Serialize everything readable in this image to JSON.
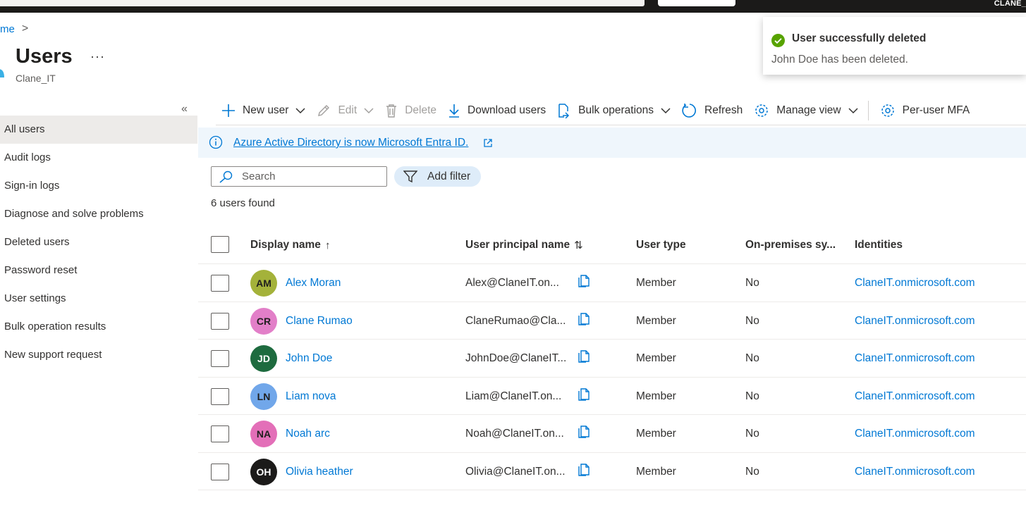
{
  "topbar": {
    "tenant": "CLANE_"
  },
  "breadcrumb": {
    "home": "me",
    "separator": ">"
  },
  "page": {
    "title": "Users",
    "more": "···",
    "subtitle": "Clane_IT"
  },
  "sidebar": {
    "collapse": "«",
    "items": [
      {
        "label": "All users",
        "active": true
      },
      {
        "label": "Audit logs"
      },
      {
        "label": "Sign-in logs"
      },
      {
        "label": "Diagnose and solve problems"
      },
      {
        "label": "Deleted users"
      },
      {
        "label": "Password reset"
      },
      {
        "label": "User settings"
      },
      {
        "label": "Bulk operation results"
      },
      {
        "label": "New support request"
      }
    ]
  },
  "toolbar": {
    "new_user": "New user",
    "edit": "Edit",
    "delete": "Delete",
    "download": "Download users",
    "bulk": "Bulk operations",
    "refresh": "Refresh",
    "manage_view": "Manage view",
    "mfa": "Per-user MFA"
  },
  "banner": {
    "text": "Azure Active Directory is now Microsoft Entra ID."
  },
  "filters": {
    "search_placeholder": "Search",
    "add_filter": "Add filter"
  },
  "result_count": "6 users found",
  "table": {
    "columns": {
      "display_name": "Display name",
      "display_name_sort": "↑",
      "upn": "User principal name",
      "upn_sort": "⇅",
      "user_type": "User type",
      "onprem": "On-premises sy...",
      "identities": "Identities"
    },
    "rows": [
      {
        "initials": "AM",
        "avatar_color": "#a4b23a",
        "name": "Alex Moran",
        "upn": "Alex@ClaneIT.on...",
        "type": "Member",
        "onprem": "No",
        "identity": "ClaneIT.onmicrosoft.com"
      },
      {
        "initials": "CR",
        "avatar_color": "#e27fc8",
        "name": "Clane Rumao",
        "upn": "ClaneRumao@Cla...",
        "type": "Member",
        "onprem": "No",
        "identity": "ClaneIT.onmicrosoft.com"
      },
      {
        "initials": "JD",
        "avatar_color": "#1e6b3f",
        "name": "John Doe",
        "upn": "JohnDoe@ClaneIT...",
        "type": "Member",
        "onprem": "No",
        "identity": "ClaneIT.onmicrosoft.com"
      },
      {
        "initials": "LN",
        "avatar_color": "#71a7ea",
        "name": "Liam nova",
        "upn": "Liam@ClaneIT.on...",
        "type": "Member",
        "onprem": "No",
        "identity": "ClaneIT.onmicrosoft.com"
      },
      {
        "initials": "NA",
        "avatar_color": "#e36fb8",
        "name": "Noah arc",
        "upn": "Noah@ClaneIT.on...",
        "type": "Member",
        "onprem": "No",
        "identity": "ClaneIT.onmicrosoft.com"
      },
      {
        "initials": "OH",
        "avatar_color": "#1b1a19",
        "name": "Olivia heather",
        "upn": "Olivia@ClaneIT.on...",
        "type": "Member",
        "onprem": "No",
        "identity": "ClaneIT.onmicrosoft.com"
      }
    ]
  },
  "toast": {
    "title": "User successfully deleted",
    "body": "John Doe has been deleted."
  },
  "colors": {
    "accent": "#0078d4",
    "success": "#57a300",
    "banner_bg": "#eff6fc",
    "filter_bg": "#deecf9"
  }
}
